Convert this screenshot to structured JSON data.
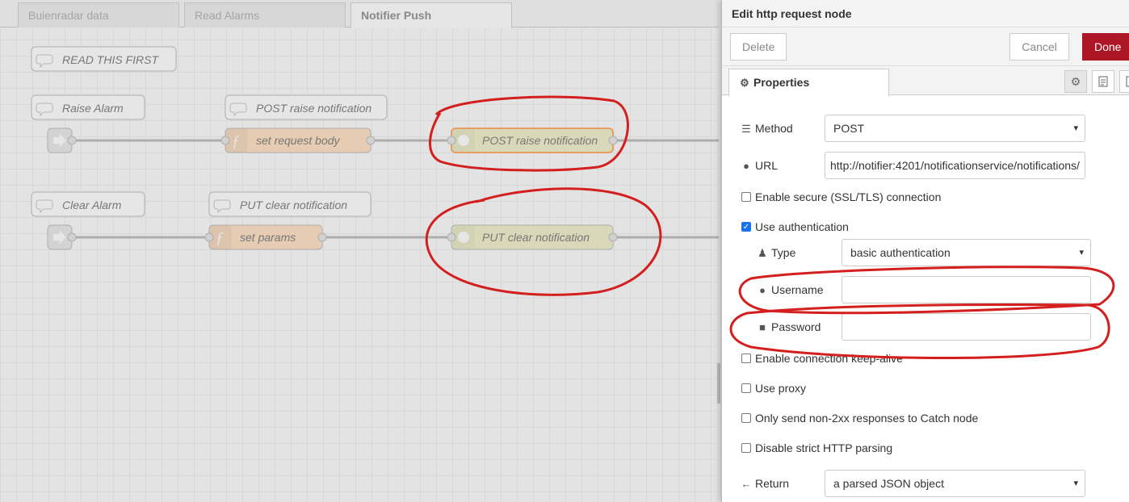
{
  "workspace": {
    "tabs": [
      {
        "label": "Buienradar data"
      },
      {
        "label": "Read Alarms"
      },
      {
        "label": "Notifier Push"
      }
    ],
    "comments": [
      {
        "label": "READ THIS FIRST"
      },
      {
        "label": "Raise Alarm"
      },
      {
        "label": "POST raise notification"
      },
      {
        "label": "Clear Alarm"
      },
      {
        "label": "PUT clear notification"
      }
    ],
    "nodes": [
      {
        "label": "set request body",
        "type": "function"
      },
      {
        "label": "POST raise notification",
        "type": "http request"
      },
      {
        "label": "set params",
        "type": "function"
      },
      {
        "label": "PUT clear notification",
        "type": "http request"
      }
    ]
  },
  "dialog": {
    "title": "Edit http request node",
    "delete_label": "Delete",
    "cancel_label": "Cancel",
    "done_label": "Done",
    "tab_properties": "Properties",
    "method": {
      "label": "Method",
      "value": "POST",
      "icon": "list-icon"
    },
    "url": {
      "label": "URL",
      "value": "http://notifier:4201/notificationservice/notifications/",
      "icon": "globe-icon"
    },
    "enable_secure": {
      "label": "Enable secure (SSL/TLS) connection",
      "checked": false
    },
    "use_auth": {
      "label": "Use authentication",
      "checked": true
    },
    "auth_type": {
      "label": "Type",
      "value": "basic authentication",
      "icon": "user-secret-icon"
    },
    "username": {
      "label": "Username",
      "value": "",
      "icon": "user-icon"
    },
    "password": {
      "label": "Password",
      "value": "",
      "icon": "lock-icon"
    },
    "keep_alive": {
      "label": "Enable connection keep-alive",
      "checked": false
    },
    "use_proxy": {
      "label": "Use proxy",
      "checked": false
    },
    "non_2xx": {
      "label": "Only send non-2xx responses to Catch node",
      "checked": false
    },
    "strict_http": {
      "label": "Disable strict HTTP parsing",
      "checked": false
    },
    "return": {
      "label": "Return",
      "value": "a parsed JSON object",
      "icon": "arrow-left-icon"
    }
  },
  "colors": {
    "done_button": "#ad1625",
    "function_node": "#fdd0a2",
    "http_node": "#e7e7ae",
    "annotation": "#d41f1f"
  }
}
